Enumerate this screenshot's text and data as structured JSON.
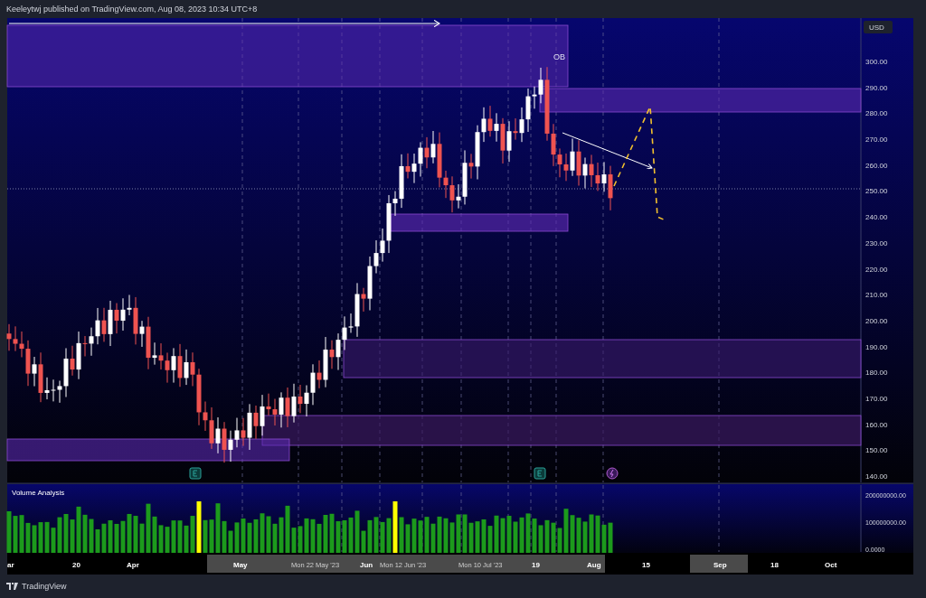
{
  "header": {
    "publisher": "Keeleytwj published on TradingView.com, Aug 08, 2023 10:34 UTC+8"
  },
  "price_chart": {
    "zone_label": "OB",
    "currency": "USD",
    "price_ticks": [
      "300.00",
      "290.00",
      "280.00",
      "270.00",
      "260.00",
      "250.00",
      "240.00",
      "230.00",
      "220.00",
      "210.00",
      "200.00",
      "190.00",
      "180.00",
      "170.00",
      "160.00",
      "150.00",
      "140.00"
    ]
  },
  "volume_pane": {
    "title": "Volume Analysis",
    "ticks": [
      "200000000.00",
      "100000000.00",
      "0.0000"
    ]
  },
  "time_axis": {
    "labels": [
      "ar",
      "20",
      "Apr",
      "May",
      "Mon 22 May '23",
      "Jun",
      "Mon 12 Jun '23",
      "Mon 10 Jul '23",
      "19",
      "Aug",
      "15",
      "Sep",
      "18",
      "Oct"
    ]
  },
  "footer": {
    "brand": "TradingView"
  }
}
